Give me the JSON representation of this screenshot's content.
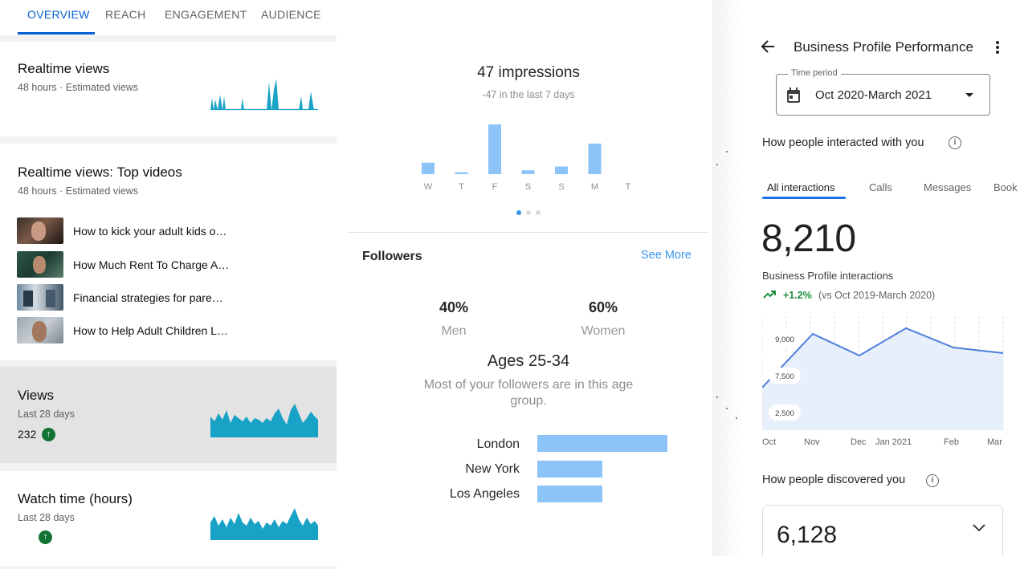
{
  "youtube": {
    "tabs": [
      "OVERVIEW",
      "REACH",
      "ENGAGEMENT",
      "AUDIENCE"
    ],
    "realtime": {
      "title": "Realtime views",
      "subtitle": "48 hours · Estimated views"
    },
    "top_videos": {
      "title": "Realtime views: Top videos",
      "subtitle": "48 hours · Estimated views",
      "videos": [
        "How to kick your adult kids o…",
        "How Much Rent To Charge A…",
        "Financial strategies for pare…",
        "How to Help Adult Children L…"
      ]
    },
    "views": {
      "title": "Views",
      "subtitle": "Last 28 days",
      "value": "232"
    },
    "watch_time": {
      "title": "Watch time (hours)",
      "subtitle": "Last 28 days"
    },
    "colors": {
      "accent": "#065fd4",
      "spark": "#17a2c6",
      "up": "#137333"
    }
  },
  "instagram": {
    "impressions_title": "47 impressions",
    "impressions_delta": "-47 in the last 7 days",
    "chart_data": {
      "type": "bar",
      "categories": [
        "W",
        "T",
        "F",
        "S",
        "S",
        "M",
        "T"
      ],
      "values": [
        6,
        1,
        26,
        2,
        4,
        16,
        0
      ]
    },
    "followers_title": "Followers",
    "see_more": "See More",
    "men_pct": "40%",
    "men_label": "Men",
    "women_pct": "60%",
    "women_label": "Women",
    "age_title": "Ages 25-34",
    "age_desc_1": "Most of your followers are in this age",
    "age_desc_2": "group.",
    "cities": [
      {
        "name": "London",
        "share": 1.0
      },
      {
        "name": "New York",
        "share": 0.5
      },
      {
        "name": "Los Angeles",
        "share": 0.5
      }
    ],
    "colors": {
      "bar": "#8cc4f8",
      "link": "#3897f0"
    }
  },
  "gbp": {
    "title": "Business Profile Performance",
    "time_period_label": "Time period",
    "time_period_value": "Oct 2020-March 2021",
    "interacted_heading": "How people interacted with you",
    "tabs": [
      "All interactions",
      "Calls",
      "Messages",
      "Book"
    ],
    "total": "8,210",
    "total_label": "Business Profile interactions",
    "change": "+1.2%",
    "change_vs": "(vs Oct 2019-March 2020)",
    "chart_data": {
      "type": "area",
      "x": [
        "Oct",
        "Nov",
        "Dec",
        "Jan 2021",
        "Feb",
        "Mar"
      ],
      "y": [
        5300,
        8650,
        7300,
        9000,
        7800,
        7450
      ],
      "y_ticks": [
        "9,000",
        "7,500",
        "2,500"
      ],
      "x_labels": [
        "Oct",
        "Nov",
        "Dec",
        "Jan 2021",
        "Feb",
        "Mar"
      ]
    },
    "discovered_heading": "How people discovered you",
    "discovered_value": "6,128",
    "colors": {
      "line": "#4e7fdb",
      "fill": "#e7effb",
      "up": "#1e8e3e"
    }
  }
}
